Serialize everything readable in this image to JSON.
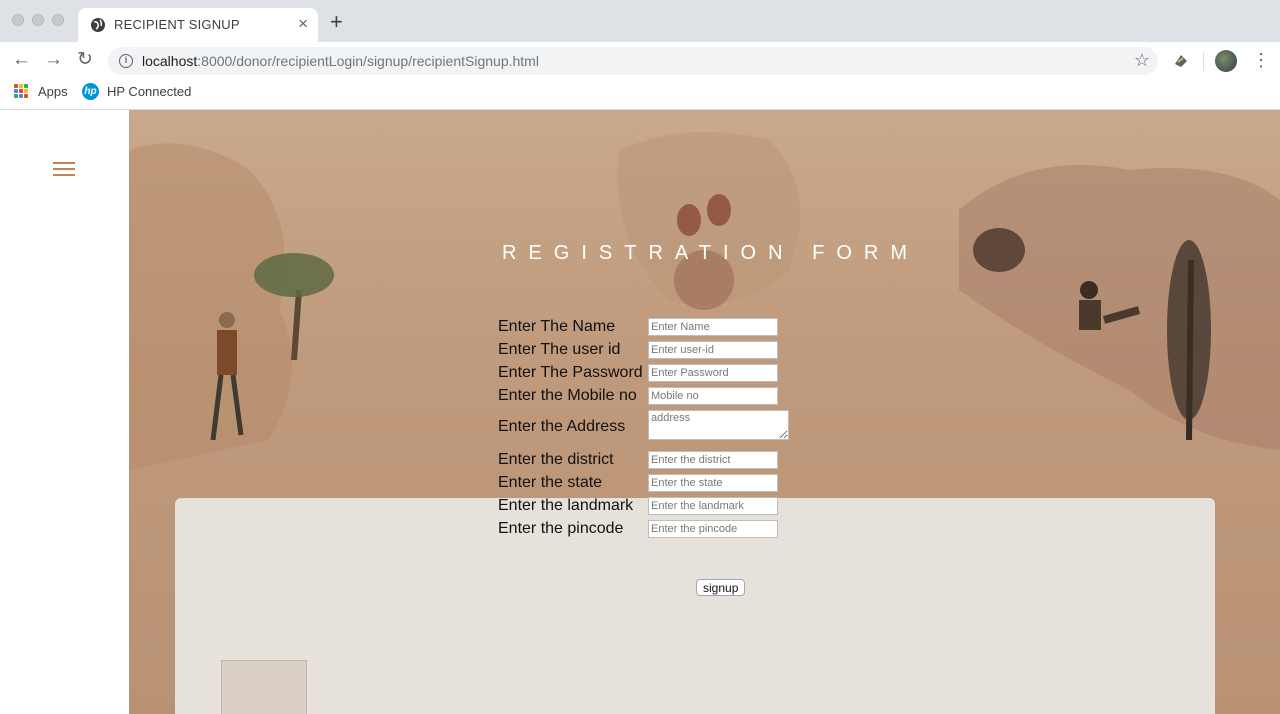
{
  "browser": {
    "tab_title": "RECIPIENT SIGNUP",
    "tab_close": "×",
    "new_tab": "+",
    "url_host": "localhost",
    "url_path": ":8000/donor/recipientLogin/signup/recipientSignup.html",
    "bookmarks": [
      {
        "label": "Apps"
      },
      {
        "label": "HP Connected"
      }
    ],
    "hp_logo_text": "hp"
  },
  "form": {
    "title": "REGISTRATION FORM",
    "fields": [
      {
        "label": "Enter The Name",
        "placeholder": "Enter Name"
      },
      {
        "label": "Enter The user id",
        "placeholder": "Enter user-id"
      },
      {
        "label": "Enter The Password",
        "placeholder": "Enter Password"
      },
      {
        "label": "Enter the Mobile no",
        "placeholder": "Mobile no"
      },
      {
        "label": "Enter the Address",
        "placeholder": "address"
      },
      {
        "label": "Enter the district",
        "placeholder": "Enter the district"
      },
      {
        "label": "Enter the state",
        "placeholder": "Enter the state"
      },
      {
        "label": "Enter the landmark",
        "placeholder": "Enter the landmark"
      },
      {
        "label": "Enter the pincode",
        "placeholder": "Enter the pincode"
      }
    ],
    "submit_label": "signup"
  },
  "colors": {
    "accent": "#c0844c",
    "apps_grid": [
      "#ea4335",
      "#fbbc05",
      "#34a853",
      "#4285f4",
      "#ea4335",
      "#fbbc05",
      "#34a853",
      "#4285f4",
      "#ea4335"
    ]
  }
}
